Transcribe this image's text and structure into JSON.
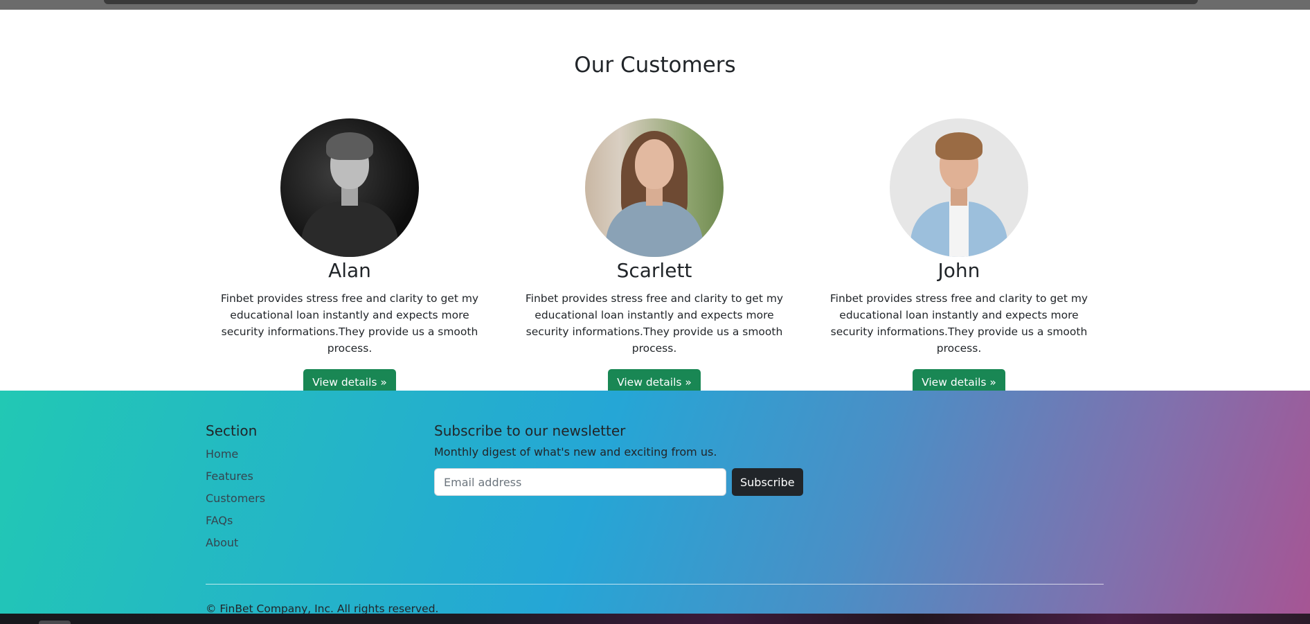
{
  "customers": {
    "title": "Our Customers",
    "items": [
      {
        "name": "Alan",
        "text": "Finbet provides stress free and clarity to get my educational loan instantly and expects more security informations.They provide us a smooth process.",
        "button": "View details »"
      },
      {
        "name": "Scarlett",
        "text": "Finbet provides stress free and clarity to get my educational loan instantly and expects more security informations.They provide us a smooth process.",
        "button": "View details »"
      },
      {
        "name": "John",
        "text": "Finbet provides stress free and clarity to get my educational loan instantly and expects more security informations.They provide us a smooth process.",
        "button": "View details »"
      }
    ]
  },
  "footer": {
    "section_heading": "Section",
    "links": [
      "Home",
      "Features",
      "Customers",
      "FAQs",
      "About"
    ],
    "newsletter": {
      "heading": "Subscribe to our newsletter",
      "description": "Monthly digest of what's new and exciting from us.",
      "email_placeholder": "Email address",
      "subscribe_label": "Subscribe"
    },
    "copyright": "© FinBet Company, Inc. All rights reserved."
  },
  "colors": {
    "button_green": "#198754",
    "subscribe_dark": "#212529",
    "footer_gradient_start": "#22c8b4",
    "footer_gradient_mid": "#25a6d6",
    "footer_gradient_end": "#a65594"
  }
}
